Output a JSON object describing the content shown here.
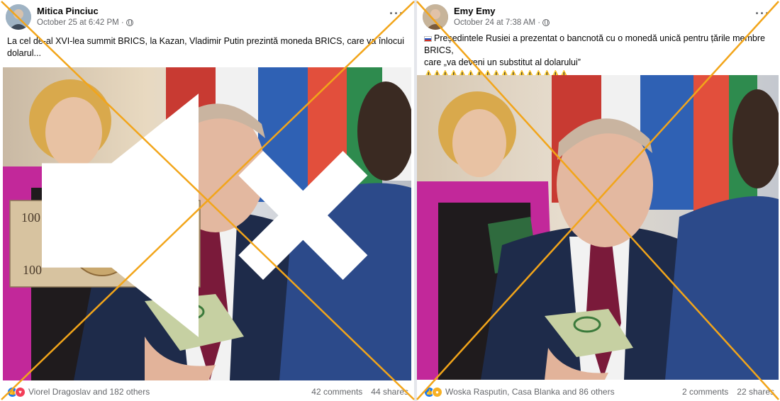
{
  "accent_colors": {
    "cross": "#f2a51a",
    "fb_blue": "#1877f2",
    "meta_gray": "#65676b"
  },
  "posts": [
    {
      "author": "Mitica Pinciuc",
      "timestamp": "October 25 at 6:42 PM ·",
      "caption_lines": [
        "La cel de-al XVI-lea summit BRICS, la Kazan, Vladimir Putin prezintă moneda BRICS, care va înlocui",
        "dolarul..."
      ],
      "reaction_icons": [
        "like-icon",
        "love-icon"
      ],
      "reactors": "Viorel Dragoslav and 182 others",
      "comments": "42 comments",
      "shares": "44 shares",
      "banknote_text": [
        "100",
        "100",
        "100",
        "100"
      ]
    },
    {
      "author": "Emy Emy",
      "timestamp": "October 24 at 7:38 AM ·",
      "caption_lines": [
        "Președintele Rusiei a prezentat o bancnotă cu o monedă unică pentru țările membre BRICS,",
        "care „va deveni un substitut al dolarului”"
      ],
      "warning_emojis": "⚠️⚠️⚠️⚠️⚠️⚠️⚠️⚠️⚠️⚠️⚠️⚠️⚠️⚠️⚠️⚠️⚠️",
      "reaction_icons": [
        "like-icon",
        "wow-icon"
      ],
      "reactors": "Woska Rasputin, Casa Blanka and 86 others",
      "comments": "2 comments",
      "shares": "22 shares"
    }
  ]
}
